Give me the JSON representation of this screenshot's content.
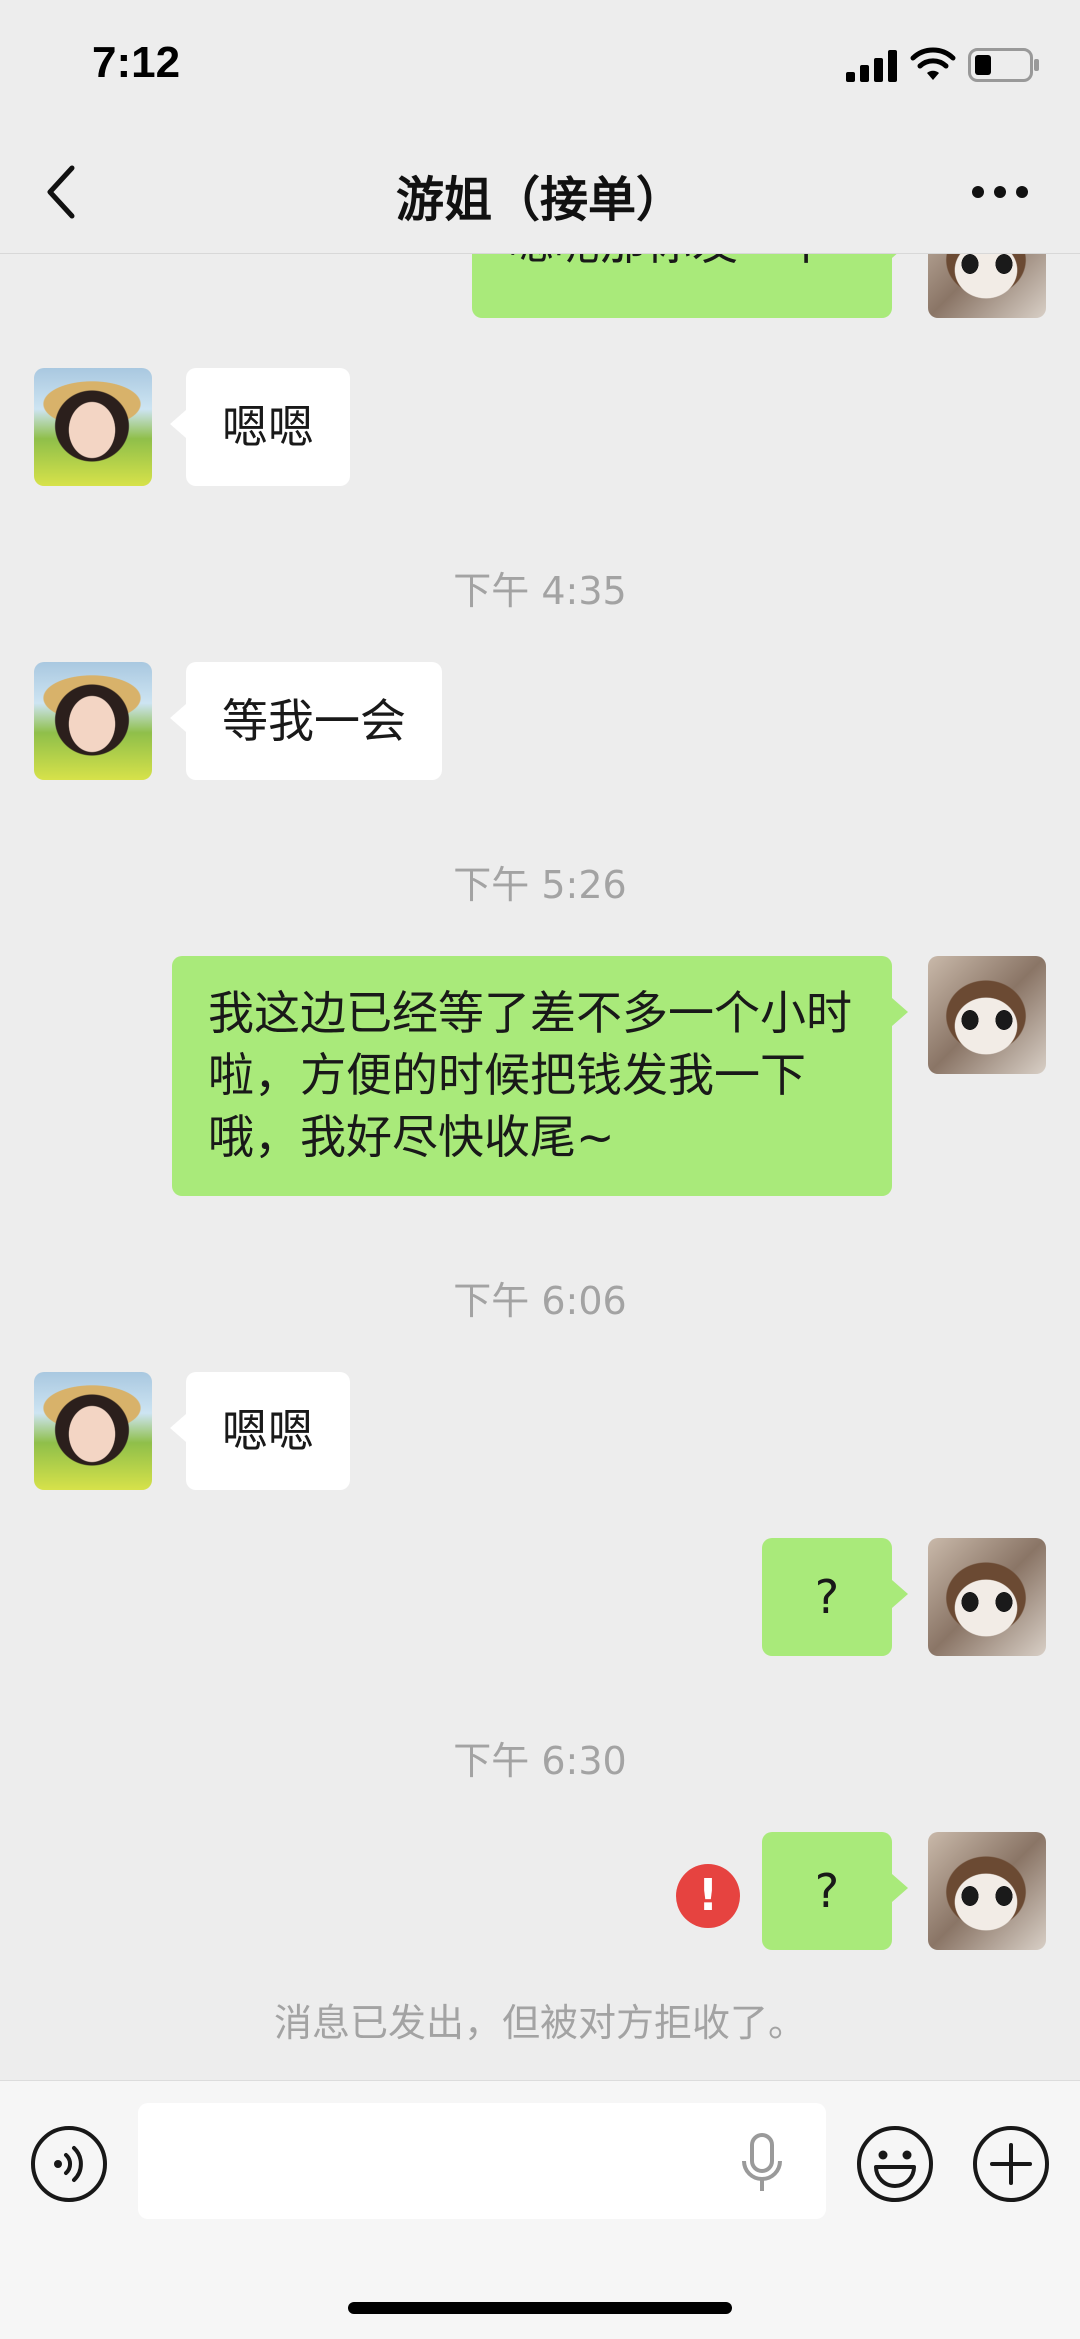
{
  "status_bar": {
    "time": "7:12"
  },
  "header": {
    "title": "游姐（接单）"
  },
  "messages": {
    "m0": {
      "text": "嗯呢那你发一下"
    },
    "m1": {
      "text": "嗯嗯"
    },
    "t1": {
      "text": "下午 4:35"
    },
    "m2": {
      "text": "等我一会"
    },
    "t2": {
      "text": "下午 5:26"
    },
    "m3": {
      "text": "我这边已经等了差不多一个小时啦，方便的时候把钱发我一下哦，我好尽快收尾~"
    },
    "t3": {
      "text": "下午 6:06"
    },
    "m4": {
      "text": "嗯嗯"
    },
    "m5": {
      "text": "?"
    },
    "t4": {
      "text": "下午 6:30"
    },
    "m6": {
      "text": "?"
    },
    "notice": {
      "text": "消息已发出，但被对方拒收了。"
    },
    "error": {
      "text": "!"
    }
  },
  "input": {
    "value": "",
    "placeholder": ""
  },
  "colors": {
    "bubble_sent": "#a9ea7a",
    "bubble_received": "#ffffff",
    "error": "#e64340",
    "background": "#ededed"
  }
}
